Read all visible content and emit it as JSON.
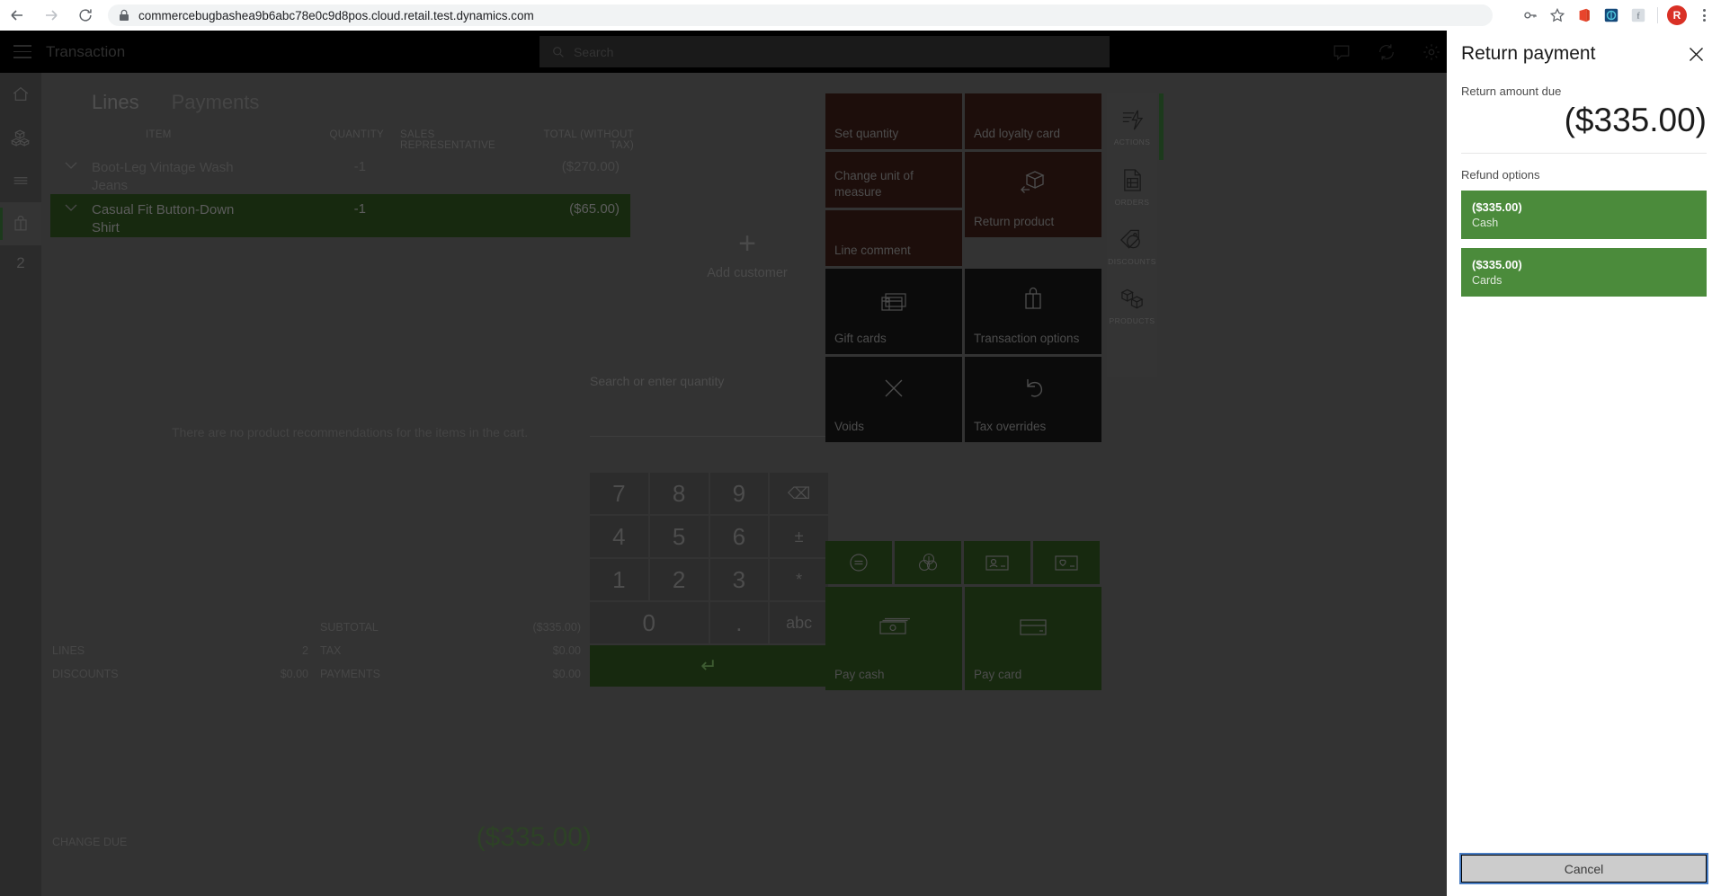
{
  "browser": {
    "url": "commercebugbashea9b6abc78e0c9d8pos.cloud.retail.test.dynamics.com",
    "back_icon": "back-arrow-icon",
    "forward_icon": "forward-arrow-icon",
    "reload_icon": "reload-icon",
    "lock_icon": "lock-icon",
    "extensions": [
      "key-icon",
      "bookmark-star-icon",
      "office-icon",
      "extension-icon",
      "extension-icon-2"
    ],
    "profile_initial": "R"
  },
  "topbar": {
    "menu_icon": "hamburger-menu-icon",
    "title": "Transaction",
    "search_placeholder": "Search",
    "search_icon": "search-icon",
    "icons": [
      "message-icon",
      "sync-icon",
      "settings-gear-icon"
    ]
  },
  "rail": {
    "items": [
      {
        "name": "home-icon"
      },
      {
        "name": "products-icon"
      },
      {
        "name": "list-icon"
      },
      {
        "name": "cart-icon",
        "active": true
      }
    ],
    "count": "2"
  },
  "tabs": [
    {
      "label": "Lines",
      "active": true
    },
    {
      "label": "Payments",
      "active": false
    }
  ],
  "cart": {
    "columns": [
      "ITEM",
      "QUANTITY",
      "SALES REPRESENTATIVE",
      "TOTAL (WITHOUT TAX)"
    ],
    "rows": [
      {
        "item": "Boot-Leg Vintage Wash Jeans",
        "quantity": "-1",
        "rep": "",
        "total": "($270.00)",
        "selected": false
      },
      {
        "item": "Casual Fit Button-Down Shirt",
        "quantity": "-1",
        "rep": "",
        "total": "($65.00)",
        "selected": true
      }
    ],
    "recommendation_text": "There are no product recommendations for the items in the cart."
  },
  "customer": {
    "plus": "+",
    "label": "Add customer"
  },
  "totals": {
    "left": [
      {
        "label": "LINES",
        "value": "2"
      },
      {
        "label": "DISCOUNTS",
        "value": "$0.00"
      }
    ],
    "right": [
      {
        "label": "SUBTOTAL",
        "value": "($335.00)"
      },
      {
        "label": "TAX",
        "value": "$0.00"
      },
      {
        "label": "PAYMENTS",
        "value": "$0.00"
      }
    ],
    "change_due_label": "CHANGE DUE",
    "change_due_value": "($335.00)"
  },
  "numpad": {
    "hint": "Search or enter quantity",
    "keys": [
      {
        "label": "7",
        "name": "key-7"
      },
      {
        "label": "8",
        "name": "key-8"
      },
      {
        "label": "9",
        "name": "key-9"
      },
      {
        "label": "⌫",
        "name": "backspace-key",
        "small": true
      },
      {
        "label": "4",
        "name": "key-4"
      },
      {
        "label": "5",
        "name": "key-5"
      },
      {
        "label": "6",
        "name": "key-6"
      },
      {
        "label": "±",
        "name": "plus-minus-key",
        "small": true
      },
      {
        "label": "1",
        "name": "key-1"
      },
      {
        "label": "2",
        "name": "key-2"
      },
      {
        "label": "3",
        "name": "key-3"
      },
      {
        "label": "*",
        "name": "asterisk-key",
        "small": true
      },
      {
        "label": "0",
        "name": "key-0",
        "wide": true
      },
      {
        "label": ".",
        "name": "decimal-key"
      },
      {
        "label": "abc",
        "name": "abc-key",
        "small": true
      }
    ],
    "enter_label": "↵"
  },
  "tiles": [
    {
      "label": "Set quantity",
      "icon": "",
      "style": "maroon",
      "height": "h1"
    },
    {
      "label": "Add loyalty card",
      "icon": "",
      "style": "maroon",
      "height": "h1"
    },
    {
      "label": "Change unit of measure",
      "icon": "",
      "style": "maroon",
      "height": "h2"
    },
    {
      "label": "Return product",
      "icon": "return-box-icon",
      "style": "maroon",
      "height": "h-big"
    },
    {
      "label": "Line comment",
      "icon": "",
      "style": "maroon",
      "height": "h1"
    },
    {
      "label": "Gift cards",
      "icon": "gift-card-icon",
      "style": "dark",
      "height": "h-big"
    },
    {
      "label": "Transaction options",
      "icon": "shopping-bag-icon",
      "style": "dark",
      "height": "h-big"
    },
    {
      "label": "Voids",
      "icon": "close-x-icon",
      "style": "dark",
      "height": "h-big"
    },
    {
      "label": "Tax overrides",
      "icon": "undo-arrow-icon",
      "style": "dark",
      "height": "h-big"
    }
  ],
  "minitiles": [
    {
      "name": "total-discount-icon"
    },
    {
      "name": "currency-coins-icon"
    },
    {
      "name": "id-card-icon"
    },
    {
      "name": "loyalty-card-icon"
    }
  ],
  "paytiles": [
    {
      "label": "Pay cash",
      "icon": "cash-icon"
    },
    {
      "label": "Pay card",
      "icon": "credit-card-icon"
    }
  ],
  "right_rail": [
    {
      "label": "ACTIONS",
      "icon": "actions-lightning-icon",
      "active": true
    },
    {
      "label": "ORDERS",
      "icon": "orders-document-icon",
      "active": false
    },
    {
      "label": "DISCOUNTS",
      "icon": "discount-tag-icon",
      "active": false
    },
    {
      "label": "PRODUCTS",
      "icon": "products-boxes-icon",
      "active": false
    }
  ],
  "panel": {
    "title": "Return payment",
    "close_icon": "close-icon",
    "amount_label": "Return amount due",
    "amount_value": "($335.00)",
    "options_label": "Refund options",
    "options": [
      {
        "amount": "($335.00)",
        "name": "Cash"
      },
      {
        "amount": "($335.00)",
        "name": "Cards"
      }
    ],
    "cancel_label": "Cancel"
  },
  "colors": {
    "accent_green": "#4b8b3b",
    "panel_bg": "#ffffff",
    "app_bg": "#333333",
    "focus_blue": "#4a7ec4"
  }
}
